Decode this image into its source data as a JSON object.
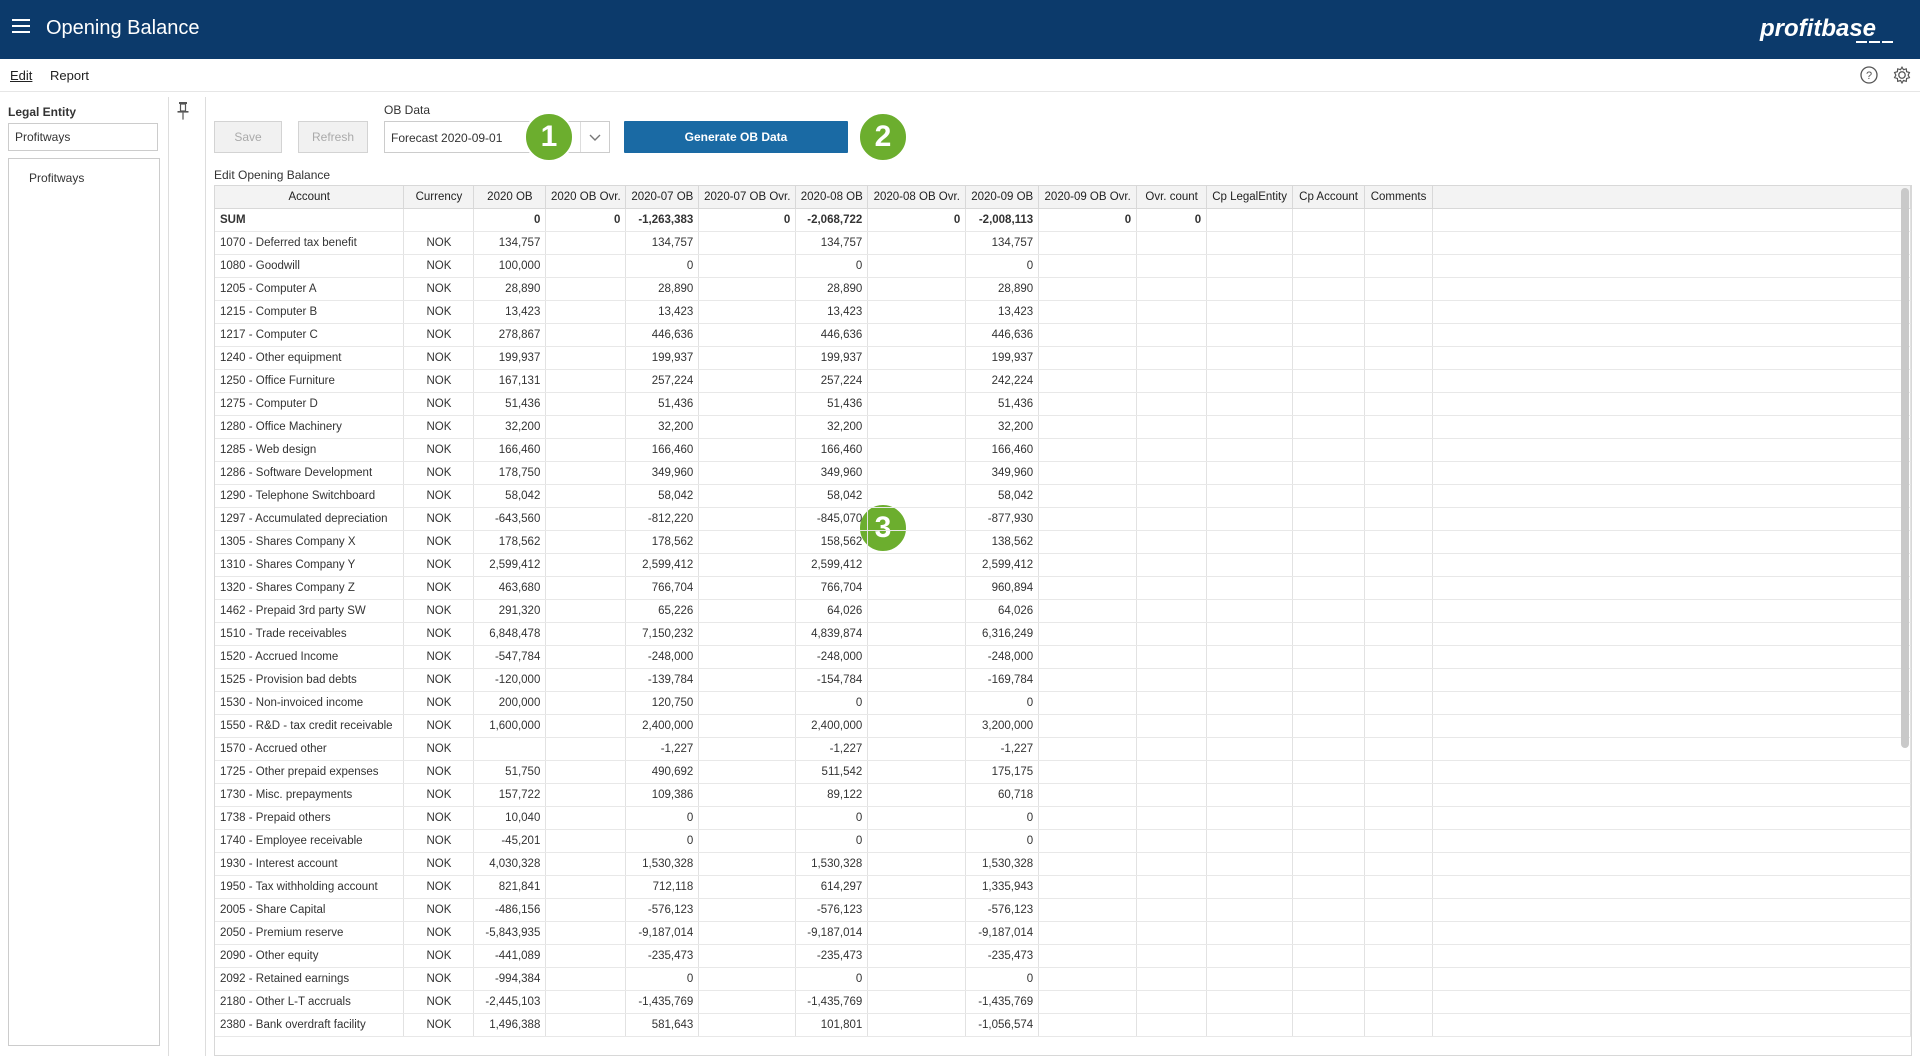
{
  "header": {
    "title": "Opening Balance",
    "logo_text": "profitbase"
  },
  "menu": {
    "edit": "Edit",
    "report": "Report"
  },
  "sidebar": {
    "label": "Legal Entity",
    "input_value": "Profitways",
    "items": [
      {
        "label": "Profitways"
      }
    ]
  },
  "toolbar": {
    "save_label": "Save",
    "refresh_label": "Refresh",
    "ob_label": "OB Data",
    "ob_value": "Forecast 2020-09-01",
    "generate_label": "Generate OB Data"
  },
  "badges": [
    "1",
    "2",
    "3"
  ],
  "grid": {
    "title": "Edit Opening Balance",
    "columns": [
      "Account",
      "Currency",
      "2020 OB",
      "2020 OB Ovr.",
      "2020-07 OB",
      "2020-07 OB Ovr.",
      "2020-08 OB",
      "2020-08 OB Ovr.",
      "2020-09 OB",
      "2020-09 OB Ovr.",
      "Ovr. count",
      "Cp LegalEntity",
      "Cp Account",
      "Comments"
    ],
    "sum_row": [
      "SUM",
      "",
      "0",
      "0",
      "-1,263,383",
      "0",
      "-2,068,722",
      "0",
      "-2,008,113",
      "0",
      "0",
      "",
      "",
      ""
    ],
    "rows": [
      [
        "1070 - Deferred tax benefit",
        "NOK",
        "134,757",
        "",
        "134,757",
        "",
        "134,757",
        "",
        "134,757",
        "",
        "",
        "",
        "",
        ""
      ],
      [
        "1080 - Goodwill",
        "NOK",
        "100,000",
        "",
        "0",
        "",
        "0",
        "",
        "0",
        "",
        "",
        "",
        "",
        ""
      ],
      [
        "1205 - Computer A",
        "NOK",
        "28,890",
        "",
        "28,890",
        "",
        "28,890",
        "",
        "28,890",
        "",
        "",
        "",
        "",
        ""
      ],
      [
        "1215 - Computer B",
        "NOK",
        "13,423",
        "",
        "13,423",
        "",
        "13,423",
        "",
        "13,423",
        "",
        "",
        "",
        "",
        ""
      ],
      [
        "1217 - Computer C",
        "NOK",
        "278,867",
        "",
        "446,636",
        "",
        "446,636",
        "",
        "446,636",
        "",
        "",
        "",
        "",
        ""
      ],
      [
        "1240 - Other equipment",
        "NOK",
        "199,937",
        "",
        "199,937",
        "",
        "199,937",
        "",
        "199,937",
        "",
        "",
        "",
        "",
        ""
      ],
      [
        "1250 - Office Furniture",
        "NOK",
        "167,131",
        "",
        "257,224",
        "",
        "257,224",
        "",
        "242,224",
        "",
        "",
        "",
        "",
        ""
      ],
      [
        "1275 - Computer D",
        "NOK",
        "51,436",
        "",
        "51,436",
        "",
        "51,436",
        "",
        "51,436",
        "",
        "",
        "",
        "",
        ""
      ],
      [
        "1280 - Office Machinery",
        "NOK",
        "32,200",
        "",
        "32,200",
        "",
        "32,200",
        "",
        "32,200",
        "",
        "",
        "",
        "",
        ""
      ],
      [
        "1285 - Web design",
        "NOK",
        "166,460",
        "",
        "166,460",
        "",
        "166,460",
        "",
        "166,460",
        "",
        "",
        "",
        "",
        ""
      ],
      [
        "1286 - Software Development",
        "NOK",
        "178,750",
        "",
        "349,960",
        "",
        "349,960",
        "",
        "349,960",
        "",
        "",
        "",
        "",
        ""
      ],
      [
        "1290 - Telephone Switchboard",
        "NOK",
        "58,042",
        "",
        "58,042",
        "",
        "58,042",
        "",
        "58,042",
        "",
        "",
        "",
        "",
        ""
      ],
      [
        "1297 - Accumulated depreciation",
        "NOK",
        "-643,560",
        "",
        "-812,220",
        "",
        "-845,070",
        "",
        "-877,930",
        "",
        "",
        "",
        "",
        ""
      ],
      [
        "1305 - Shares Company X",
        "NOK",
        "178,562",
        "",
        "178,562",
        "",
        "158,562",
        "",
        "138,562",
        "",
        "",
        "",
        "",
        ""
      ],
      [
        "1310 - Shares Company Y",
        "NOK",
        "2,599,412",
        "",
        "2,599,412",
        "",
        "2,599,412",
        "",
        "2,599,412",
        "",
        "",
        "",
        "",
        ""
      ],
      [
        "1320 - Shares Company Z",
        "NOK",
        "463,680",
        "",
        "766,704",
        "",
        "766,704",
        "",
        "960,894",
        "",
        "",
        "",
        "",
        ""
      ],
      [
        "1462 - Prepaid 3rd party SW",
        "NOK",
        "291,320",
        "",
        "65,226",
        "",
        "64,026",
        "",
        "64,026",
        "",
        "",
        "",
        "",
        ""
      ],
      [
        "1510 - Trade receivables",
        "NOK",
        "6,848,478",
        "",
        "7,150,232",
        "",
        "4,839,874",
        "",
        "6,316,249",
        "",
        "",
        "",
        "",
        ""
      ],
      [
        "1520 - Accrued Income",
        "NOK",
        "-547,784",
        "",
        "-248,000",
        "",
        "-248,000",
        "",
        "-248,000",
        "",
        "",
        "",
        "",
        ""
      ],
      [
        "1525 - Provision bad debts",
        "NOK",
        "-120,000",
        "",
        "-139,784",
        "",
        "-154,784",
        "",
        "-169,784",
        "",
        "",
        "",
        "",
        ""
      ],
      [
        "1530 - Non-invoiced income",
        "NOK",
        "200,000",
        "",
        "120,750",
        "",
        "0",
        "",
        "0",
        "",
        "",
        "",
        "",
        ""
      ],
      [
        "1550 - R&D - tax credit receivable",
        "NOK",
        "1,600,000",
        "",
        "2,400,000",
        "",
        "2,400,000",
        "",
        "3,200,000",
        "",
        "",
        "",
        "",
        ""
      ],
      [
        "1570 - Accrued other",
        "NOK",
        "",
        "",
        "-1,227",
        "",
        "-1,227",
        "",
        "-1,227",
        "",
        "",
        "",
        "",
        ""
      ],
      [
        "1725 - Other prepaid expenses",
        "NOK",
        "51,750",
        "",
        "490,692",
        "",
        "511,542",
        "",
        "175,175",
        "",
        "",
        "",
        "",
        ""
      ],
      [
        "1730 - Misc. prepayments",
        "NOK",
        "157,722",
        "",
        "109,386",
        "",
        "89,122",
        "",
        "60,718",
        "",
        "",
        "",
        "",
        ""
      ],
      [
        "1738 - Prepaid others",
        "NOK",
        "10,040",
        "",
        "0",
        "",
        "0",
        "",
        "0",
        "",
        "",
        "",
        "",
        ""
      ],
      [
        "1740 - Employee receivable",
        "NOK",
        "-45,201",
        "",
        "0",
        "",
        "0",
        "",
        "0",
        "",
        "",
        "",
        "",
        ""
      ],
      [
        "1930 - Interest account",
        "NOK",
        "4,030,328",
        "",
        "1,530,328",
        "",
        "1,530,328",
        "",
        "1,530,328",
        "",
        "",
        "",
        "",
        ""
      ],
      [
        "1950 - Tax withholding account",
        "NOK",
        "821,841",
        "",
        "712,118",
        "",
        "614,297",
        "",
        "1,335,943",
        "",
        "",
        "",
        "",
        ""
      ],
      [
        "2005 - Share Capital",
        "NOK",
        "-486,156",
        "",
        "-576,123",
        "",
        "-576,123",
        "",
        "-576,123",
        "",
        "",
        "",
        "",
        ""
      ],
      [
        "2050 - Premium reserve",
        "NOK",
        "-5,843,935",
        "",
        "-9,187,014",
        "",
        "-9,187,014",
        "",
        "-9,187,014",
        "",
        "",
        "",
        "",
        ""
      ],
      [
        "2090 - Other equity",
        "NOK",
        "-441,089",
        "",
        "-235,473",
        "",
        "-235,473",
        "",
        "-235,473",
        "",
        "",
        "",
        "",
        ""
      ],
      [
        "2092 - Retained earnings",
        "NOK",
        "-994,384",
        "",
        "0",
        "",
        "0",
        "",
        "0",
        "",
        "",
        "",
        "",
        ""
      ],
      [
        "2180 - Other L-T accruals",
        "NOK",
        "-2,445,103",
        "",
        "-1,435,769",
        "",
        "-1,435,769",
        "",
        "-1,435,769",
        "",
        "",
        "",
        "",
        ""
      ],
      [
        "2380 - Bank overdraft facility",
        "NOK",
        "1,496,388",
        "",
        "581,643",
        "",
        "101,801",
        "",
        "-1,056,574",
        "",
        "",
        "",
        "",
        ""
      ]
    ]
  },
  "icons": {
    "menu": "hamburger-icon",
    "help": "help-icon",
    "settings": "gear-icon",
    "pin": "pin-icon",
    "dropdown": "chevron-down-icon"
  },
  "colors": {
    "header_bg": "#0c3a6b",
    "primary_button": "#1a6aa4",
    "badge": "#6cae2e"
  }
}
